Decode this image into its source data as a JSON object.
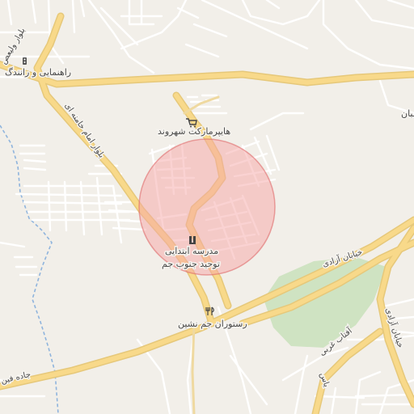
{
  "map": {
    "road_labels": {
      "blvd_valiasr": "بلوار ولیعص",
      "blvd_imam_khamenei": "بلوار امام خامنه ای",
      "street_azadi": "خیابان آزادی",
      "street_azadi_2": "خیابان آزادی",
      "street_aftab_gharbi": "آفتاب غربی",
      "road_fin": "جاده فین",
      "street_yas": "یاس"
    },
    "poi_labels": {
      "driving_school": "راهنمایی و رانندگ",
      "hypermarket": "هایپرمارکت شهروند",
      "school_line1": "مدرسه ابتدایی",
      "school_line2": "توحید جنوب جم",
      "restaurant": "رستوران جم نشین",
      "edge_label": "ـبان"
    },
    "icons": {
      "driving_school": "traffic-light-icon",
      "hypermarket": "shopping-cart-icon",
      "school": "school-icon",
      "restaurant": "restaurant-icon"
    },
    "colors": {
      "background": "#f2efe9",
      "road_casing": "#e6c87a",
      "road_fill": "#f8d98a",
      "minor_road": "#ffffff",
      "park": "#cfe3c2",
      "water": "#8fb4dd",
      "circle_fill": "#f6a5a5",
      "circle_stroke": "#e06a6a"
    }
  }
}
